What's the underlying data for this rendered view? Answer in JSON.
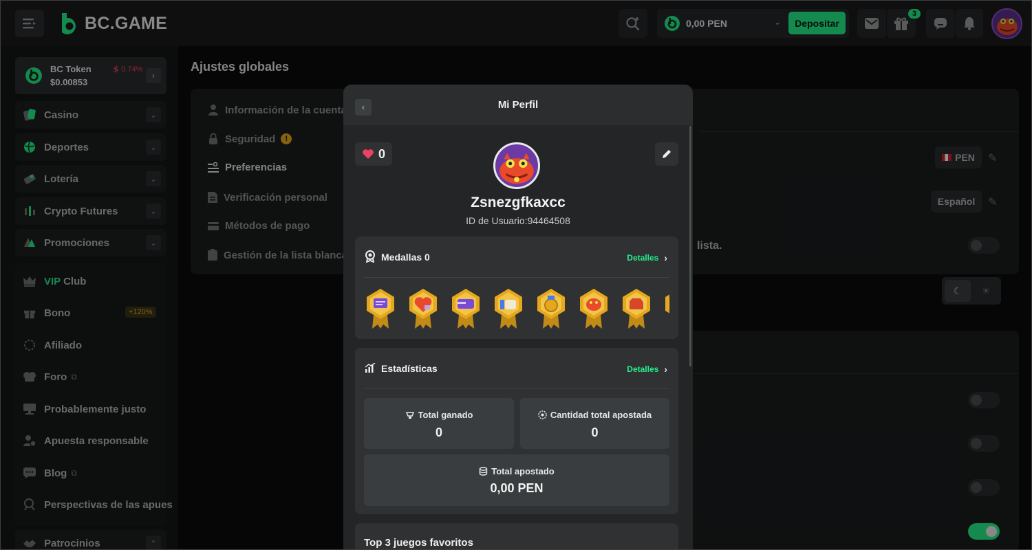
{
  "header": {
    "logo_text": "BC.GAME",
    "balance": "0,00 PEN",
    "deposit_label": "Depositar",
    "gift_count": "3",
    "icons": [
      "menu-icon",
      "search-icon",
      "wallet-coin-icon",
      "mail-icon",
      "gift-icon",
      "chat-icon",
      "bell-icon"
    ]
  },
  "sidebar": {
    "token": {
      "name": "BC Token",
      "change": "≸ 0.74%",
      "price": "$0.00853"
    },
    "groups": [
      {
        "label": "Casino",
        "icon": "casino-icon"
      },
      {
        "label": "Deportes",
        "icon": "sports-icon"
      },
      {
        "label": "Lotería",
        "icon": "lottery-icon"
      },
      {
        "label": "Crypto Futures",
        "icon": "futures-icon"
      },
      {
        "label": "Promociones",
        "icon": "promo-icon"
      }
    ],
    "vip_prefix": "VIP",
    "vip_suffix": " Club",
    "items": [
      {
        "label": "Bono",
        "badge": "+120%",
        "icon": "gift-icon"
      },
      {
        "label": "Afiliado",
        "icon": "affiliate-icon"
      },
      {
        "label": "Foro",
        "icon": "forum-icon"
      },
      {
        "label": "Probablemente justo",
        "icon": "fair-icon"
      },
      {
        "label": "Apuesta responsable",
        "icon": "responsible-icon"
      },
      {
        "label": "Blog",
        "icon": "blog-icon"
      },
      {
        "label": "Perspectivas de las apues",
        "icon": "insights-icon"
      },
      {
        "label": "Patrocinios",
        "icon": "sponsor-icon"
      }
    ]
  },
  "main": {
    "title": "Ajustes globales",
    "menu": [
      {
        "label": "Información de la cuenta"
      },
      {
        "label": "Seguridad"
      },
      {
        "label": "Preferencias"
      },
      {
        "label": "Verificación personal"
      },
      {
        "label": "Métodos de pago"
      },
      {
        "label": "Gestión de la lista blanca"
      }
    ],
    "currency_pill": "PEN",
    "language_pill": "Español",
    "fragment_text": "lista."
  },
  "modal": {
    "title": "Mi Perfil",
    "likes": "0",
    "username": "Zsnezgfkaxcc",
    "user_id": "ID de Usuario:94464508",
    "medals": {
      "title": "Medallas 0",
      "details": "Detalles"
    },
    "stats": {
      "title": "Estadísticas",
      "details": "Detalles",
      "total_won_label": "Total ganado",
      "total_won": "0",
      "total_wagered_count_label": "Cantidad total apostada",
      "total_wagered_count": "0",
      "total_wagered_label": "Total apostado",
      "total_wagered": "0,00 PEN"
    },
    "favorites_title": "Top 3 juegos favoritos"
  },
  "colors": {
    "accent": "#24ee89",
    "negative": "#ed4163",
    "gold": "#e6a71d"
  }
}
